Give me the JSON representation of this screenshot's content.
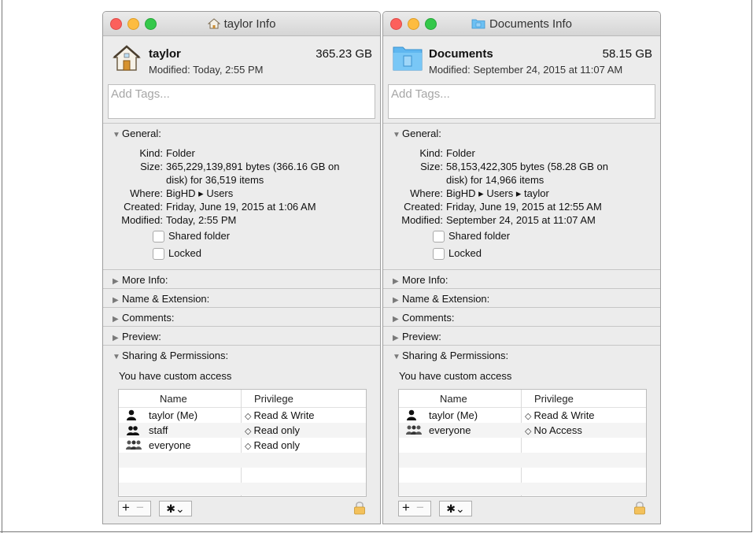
{
  "windows": [
    {
      "title": "taylor Info",
      "name": "taylor",
      "size": "365.23 GB",
      "modified_header": "Modified: Today, 2:55 PM",
      "tags_placeholder": "Add Tags...",
      "general": {
        "title": "General:",
        "kind_label": "Kind:",
        "kind": "Folder",
        "size_label": "Size:",
        "size_line1": "365,229,139,891 bytes (366.16 GB on",
        "size_line2": "disk) for 36,519 items",
        "where_label": "Where:",
        "where": "BigHD ▸ Users",
        "created_label": "Created:",
        "created": "Friday, June 19, 2015 at 1:06 AM",
        "modified_label": "Modified:",
        "modified": "Today, 2:55 PM",
        "shared_folder": "Shared folder",
        "locked": "Locked"
      },
      "sections": [
        "More Info:",
        "Name & Extension:",
        "Comments:",
        "Preview:"
      ],
      "sharing": {
        "title": "Sharing & Permissions:",
        "access": "You have custom access",
        "col_name": "Name",
        "col_privilege": "Privilege",
        "rows": [
          {
            "name": "taylor (Me)",
            "privilege": "Read & Write",
            "icon": "user-icon"
          },
          {
            "name": "staff",
            "privilege": "Read only",
            "icon": "group-icon"
          },
          {
            "name": "everyone",
            "privilege": "Read only",
            "icon": "everyone-icon"
          }
        ]
      }
    },
    {
      "title": "Documents Info",
      "name": "Documents",
      "size": "58.15 GB",
      "modified_header": "Modified: September 24, 2015 at 11:07 AM",
      "tags_placeholder": "Add Tags...",
      "general": {
        "title": "General:",
        "kind_label": "Kind:",
        "kind": "Folder",
        "size_label": "Size:",
        "size_line1": "58,153,422,305 bytes (58.28 GB on",
        "size_line2": "disk) for 14,966 items",
        "where_label": "Where:",
        "where": "BigHD ▸ Users ▸ taylor",
        "created_label": "Created:",
        "created": "Friday, June 19, 2015 at 12:55 AM",
        "modified_label": "Modified:",
        "modified": "September 24, 2015 at 11:07 AM",
        "shared_folder": "Shared folder",
        "locked": "Locked"
      },
      "sections": [
        "More Info:",
        "Name & Extension:",
        "Comments:",
        "Preview:"
      ],
      "sharing": {
        "title": "Sharing & Permissions:",
        "access": "You have custom access",
        "col_name": "Name",
        "col_privilege": "Privilege",
        "rows": [
          {
            "name": "taylor (Me)",
            "privilege": "Read & Write",
            "icon": "user-icon"
          },
          {
            "name": "everyone",
            "privilege": "No Access",
            "icon": "everyone-icon"
          }
        ]
      }
    }
  ],
  "icons": {
    "expanded": "▼",
    "collapsed": "▶",
    "updown": "◇",
    "plus": "+",
    "minus": "−",
    "gear": "✱⌄"
  },
  "colors": {
    "close": "#fc605c",
    "minimize": "#fdbc40",
    "zoom": "#34c84a",
    "folder_blue": "#5fb7f0",
    "lock_gold": "#f3c15c"
  }
}
